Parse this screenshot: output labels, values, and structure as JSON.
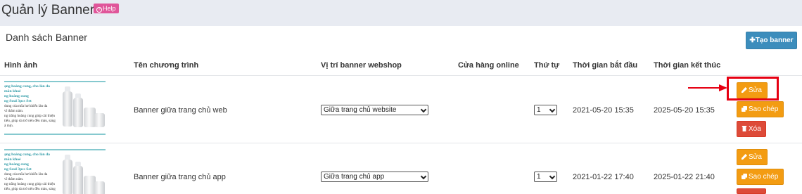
{
  "header": {
    "title": "Quản lý Banner",
    "help": "Help"
  },
  "panel": {
    "title": "Danh sách Banner",
    "create_button": "Tạo banner"
  },
  "columns": [
    "Hình ảnh",
    "Tên chương trình",
    "Vị trí banner webshop",
    "Cửa hàng online",
    "Thứ tự",
    "Thời gian bắt đầu",
    "Thời gian kết thúc"
  ],
  "thumb_text": [
    "ạng hoàng cung, cho làn da",
    "mắn khoẻ",
    "ng hoàng cung",
    "ng Soul 3pcs Set",
    "dung của mĩa hư khiến làn da",
    "vĩ thâm nám.",
    "ng trắng hoàng cung giúp cải thiện",
    "tiểu, giúp da trở nên đều màu, sáng",
    "ả mịn."
  ],
  "rows": [
    {
      "name": "Banner giữa trang chủ web",
      "position": "Giữa trang chủ website",
      "order": "1",
      "start": "2021-05-20 15:35",
      "end": "2025-05-20 15:35",
      "edit": "Sửa",
      "copy": "Sao chép",
      "delete": "Xóa"
    },
    {
      "name": "Banner giữa trang chủ app",
      "position": "Giữa trang chủ app",
      "order": "1",
      "start": "2021-01-22 17:40",
      "end": "2025-01-22 21:40",
      "edit": "Sửa",
      "copy": "Sao chép"
    }
  ],
  "colors": {
    "header_bg": "#e8ebf2",
    "primary": "#3c8dbc",
    "warning": "#f39c12",
    "danger": "#dd4b39",
    "highlight": "#e60012",
    "help_badge": "#e0569a"
  }
}
